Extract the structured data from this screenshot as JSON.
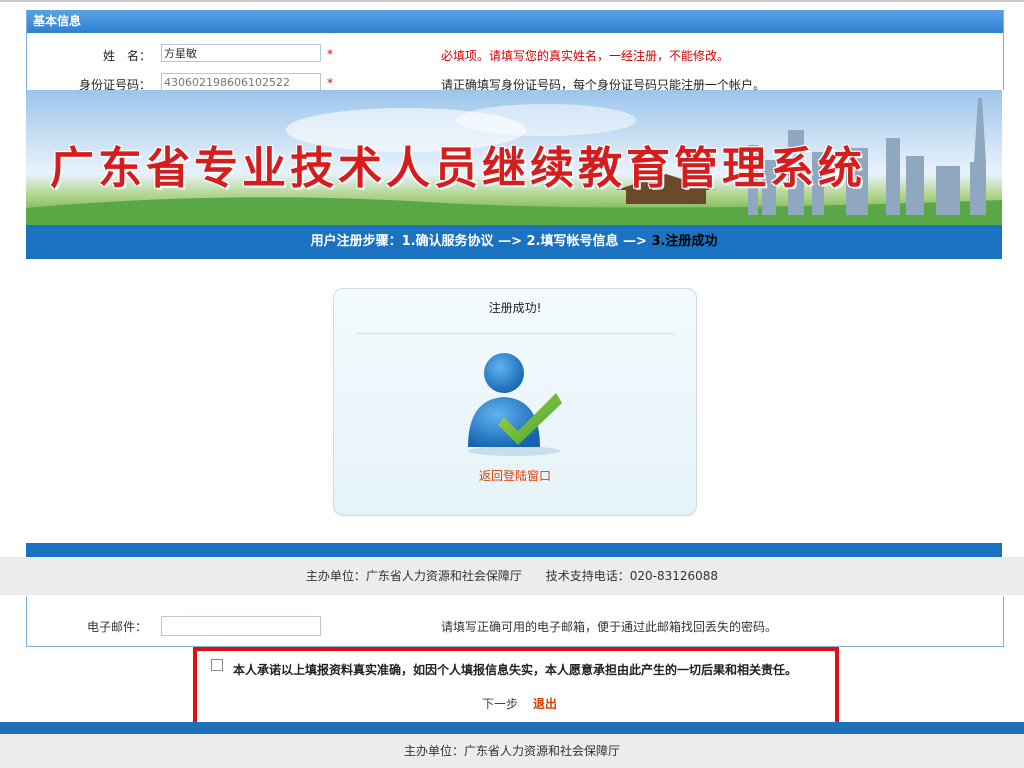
{
  "background_form": {
    "section_title": "基本信息",
    "name_label": "姓　名：",
    "name_value": "方星敏",
    "name_hint": "必填项。请填写您的真实姓名，一经注册，不能修改。",
    "id_label": "身份证号码：",
    "id_value": "430602198606102522",
    "id_hint": "请正确填写身份证号码，每个身份证号码只能注册一个帐户。",
    "required_mark": "*",
    "email_label": "电子邮件：",
    "email_hint": "请填写正确可用的电子邮箱，便于通过此邮箱找回丢失的密码。",
    "promise_text": "本人承诺以上填报资料真实准确，如因个人填报信息失实，本人愿意承担由此产生的一切后果和相关责任。",
    "next_label": "下一步",
    "exit_label": "退出",
    "footer_text": "主办单位：广东省人力资源和社会保障厅"
  },
  "overlay": {
    "banner_title": "广东省专业技术人员继续教育管理系统",
    "steps_prefix": "用户注册步骤：1.确认服务协议 —> 2.填写帐号信息 —> ",
    "steps_current": "3.注册成功",
    "success_title": "注册成功!",
    "success_icon": "user-check-icon",
    "back_link": "返回登陆窗口",
    "footer_org": "主办单位：广东省人力资源和社会保障厅",
    "footer_phone": "技术支持电话：020-83126088"
  },
  "colors": {
    "primary_blue": "#1b72c0",
    "title_red": "#d61d1d",
    "highlight_red": "#e01010",
    "link_orange": "#e04000"
  }
}
